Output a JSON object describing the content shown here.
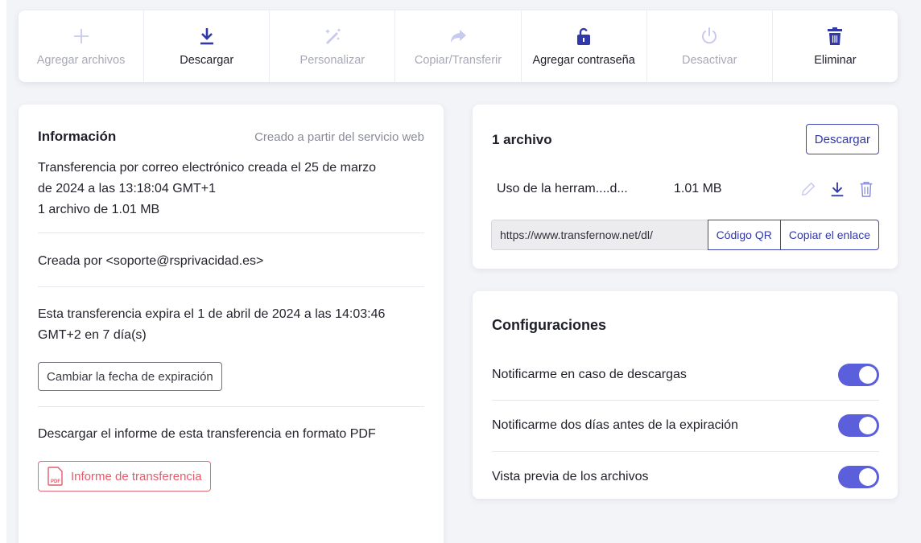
{
  "colors": {
    "accent": "#3138a8",
    "toggle_on": "#5b5fdc",
    "disabled": "#c7c9ee",
    "pdf_red": "#e45b6b"
  },
  "toolbar": {
    "buttons": [
      {
        "label": "Agregar archivos",
        "icon": "plus-icon",
        "enabled": false
      },
      {
        "label": "Descargar",
        "icon": "download-icon",
        "enabled": true
      },
      {
        "label": "Personalizar",
        "icon": "magic-wand-icon",
        "enabled": false
      },
      {
        "label": "Copiar/Transferir",
        "icon": "forward-arrow-icon",
        "enabled": false
      },
      {
        "label": "Agregar contraseña",
        "icon": "unlocked-padlock-icon",
        "enabled": true
      },
      {
        "label": "Desactivar",
        "icon": "power-icon",
        "enabled": false
      },
      {
        "label": "Eliminar",
        "icon": "trash-icon",
        "enabled": true
      }
    ]
  },
  "info": {
    "title": "Información",
    "subtitle": "Creado a partir del servicio web",
    "transfer_line": "Transferencia por correo electrónico creada el 25 de marzo de 2024 a las 13:18:04 GMT+1",
    "files_line": "1 archivo de 1.01 MB",
    "created_by": "Creada por <soporte@rsprivacidad.es>",
    "expiry_text": "Esta transferencia expira el 1 de abril de 2024 a las 14:03:46 GMT+2 en 7 día(s)",
    "change_expiry_label": "Cambiar la fecha de expiración",
    "report_text": "Descargar el informe de esta transferencia en formato PDF",
    "report_button_label": "Informe de transferencia",
    "pdf_icon_text": "PDF"
  },
  "files": {
    "title": "1 archivo",
    "download_label": "Descargar",
    "items": [
      {
        "name": "Uso de la herram....d...",
        "size": "1.01 MB"
      }
    ],
    "link_url": "https://www.transfernow.net/dl/",
    "qr_label": "Código QR",
    "copy_label": "Copiar el enlace"
  },
  "config": {
    "title": "Configuraciones",
    "items": [
      {
        "label": "Notificarme en caso de descargas",
        "on": true
      },
      {
        "label": "Notificarme dos días antes de la expiración",
        "on": true
      },
      {
        "label": "Vista previa de los archivos",
        "on": true
      }
    ]
  }
}
